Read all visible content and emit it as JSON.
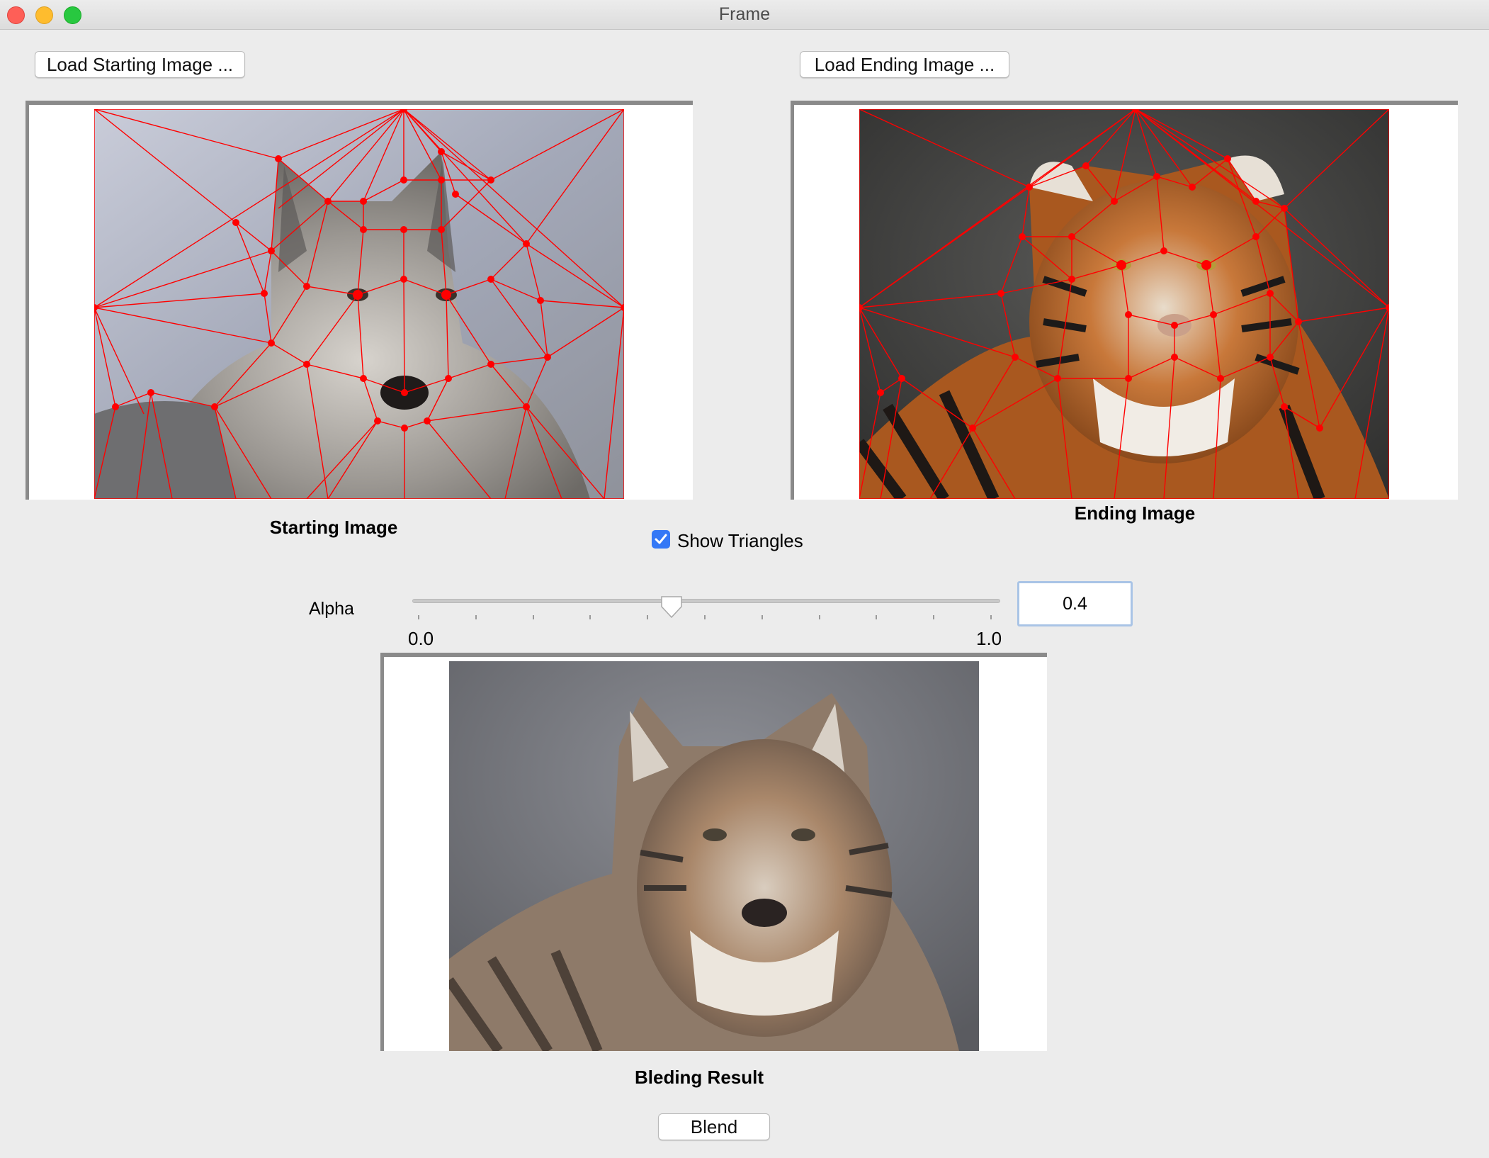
{
  "window": {
    "title": "Frame"
  },
  "buttons": {
    "load_start": "Load Starting Image ...",
    "load_end": "Load Ending Image ...",
    "blend": "Blend"
  },
  "captions": {
    "start": "Starting Image",
    "end": "Ending Image",
    "result": "Bleding Result"
  },
  "show_triangles": {
    "label": "Show Triangles",
    "checked": true
  },
  "alpha": {
    "label": "Alpha",
    "value": 0.4,
    "display": "0.4",
    "min_label": "0.0",
    "max_label": "1.0",
    "tick_count": 11
  },
  "colors": {
    "mesh": "#ff0000",
    "accent": "#3478f6"
  },
  "images": {
    "start": "wolf photo with triangle mesh overlay",
    "end": "tiger photo with triangle mesh overlay",
    "result": "wolf-tiger blended photo"
  }
}
